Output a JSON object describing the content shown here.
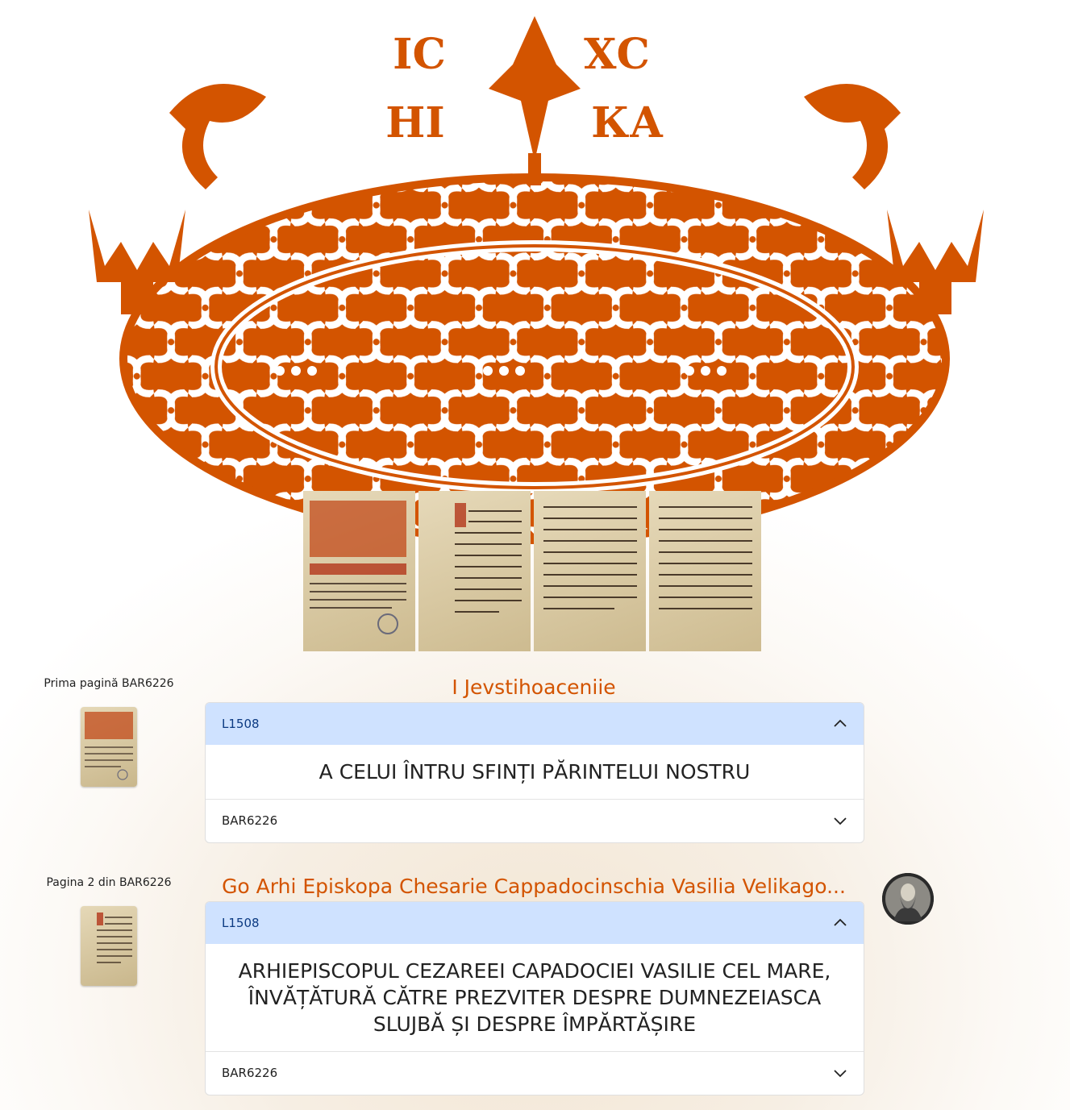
{
  "colors": {
    "accent": "#d35400",
    "header_bg": "#cfe2ff",
    "header_text": "#0c3a82"
  },
  "hero": {
    "monogram_top_left": "ІС",
    "monogram_top_right": "ХС",
    "monogram_bottom_left": "НІ",
    "monogram_bottom_right": "КА"
  },
  "entries": [
    {
      "side_label": "Prima pagină BAR6226",
      "title": "I Jevstihoaceniie",
      "code": "L1508",
      "body": "A CELUI ÎNTRU SFINȚI PĂRINTELUI NOSTRU",
      "source": "BAR6226"
    },
    {
      "side_label": "Pagina 2 din BAR6226",
      "title": "Go Arhi Episkopa Chesarie Cappadocinschia Vasilia Velikago...",
      "code": "L1508",
      "body": "ARHIEPISCOPUL CEZAREEI CAPADOCIEI VASILIE CEL MARE, ÎNVĂȚĂTURĂ CĂTRE PREZVITER DESPRE DUMNEZEIASCA SLUJBĂ ȘI DESPRE ÎMPĂRTĂȘIRE",
      "source": "BAR6226"
    }
  ],
  "icons": {
    "hero": "ornament-icon",
    "expand": "chevron-up-icon",
    "collapse": "chevron-down-icon",
    "avatar": "saint-portrait-icon"
  }
}
